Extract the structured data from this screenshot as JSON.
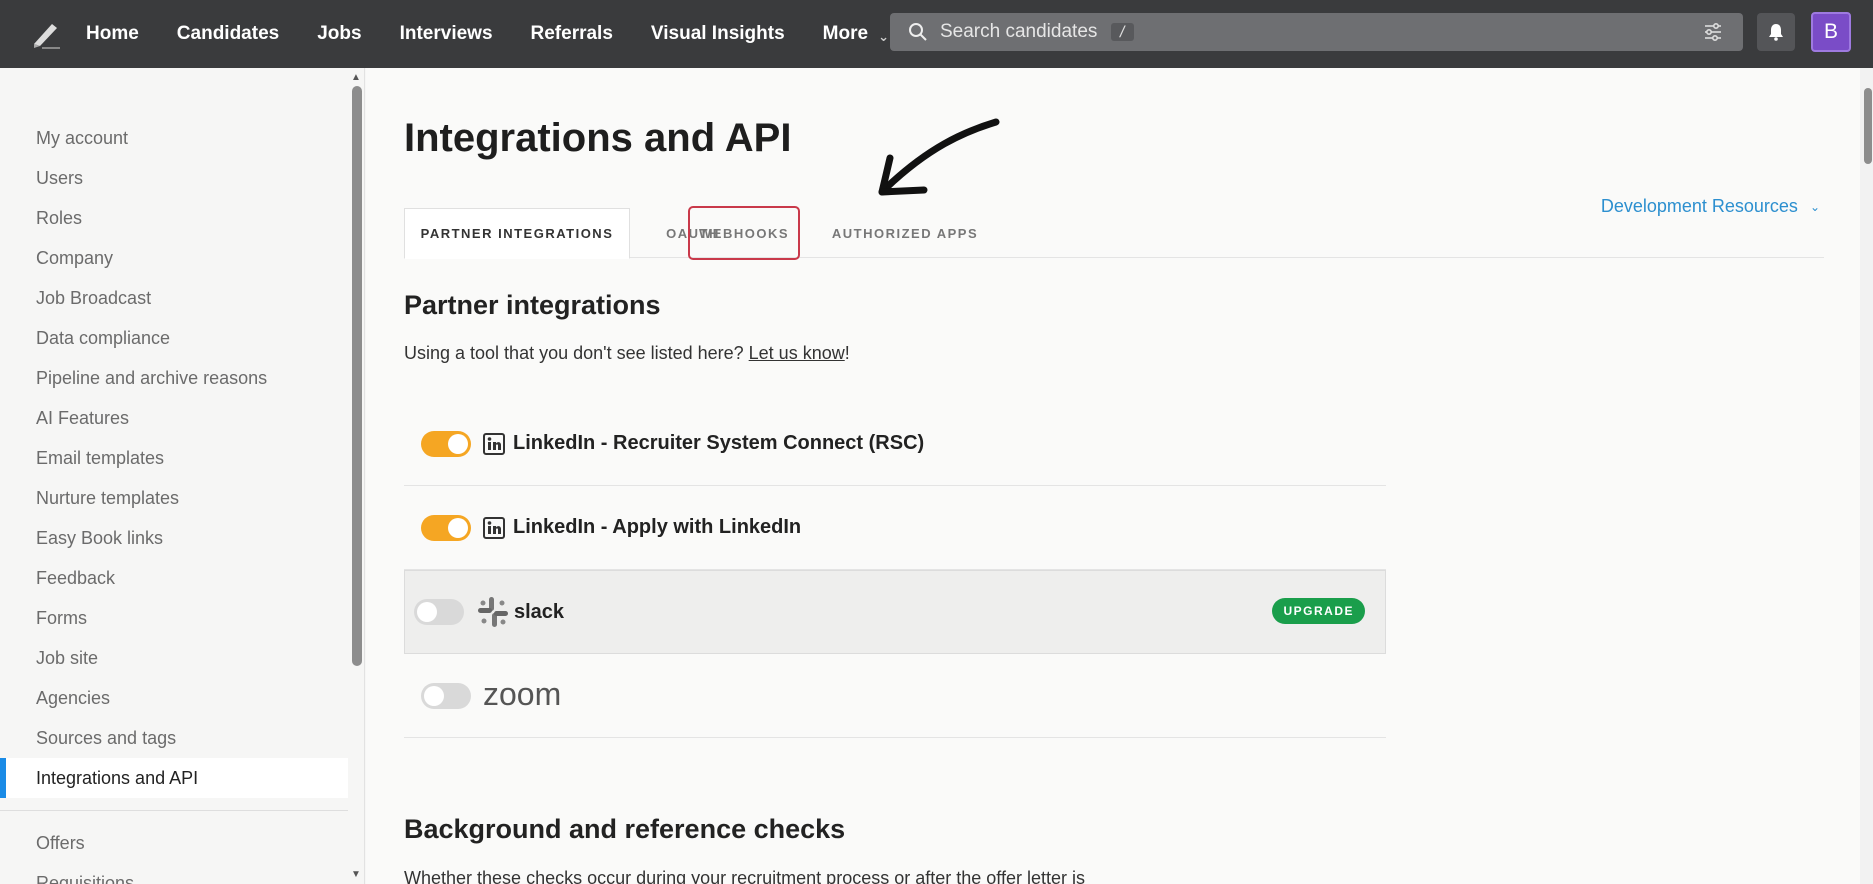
{
  "nav": {
    "items": [
      {
        "label": "Home"
      },
      {
        "label": "Candidates"
      },
      {
        "label": "Jobs"
      },
      {
        "label": "Interviews"
      },
      {
        "label": "Referrals"
      },
      {
        "label": "Visual Insights"
      },
      {
        "label": "More"
      }
    ],
    "search_placeholder": "Search candidates",
    "search_shortcut": "/",
    "avatar_initial": "B"
  },
  "sidebar": {
    "items": [
      {
        "label": "My account"
      },
      {
        "label": "Users"
      },
      {
        "label": "Roles"
      },
      {
        "label": "Company"
      },
      {
        "label": "Job Broadcast"
      },
      {
        "label": "Data compliance"
      },
      {
        "label": "Pipeline and archive reasons"
      },
      {
        "label": "AI Features"
      },
      {
        "label": "Email templates"
      },
      {
        "label": "Nurture templates"
      },
      {
        "label": "Easy Book links"
      },
      {
        "label": "Feedback"
      },
      {
        "label": "Forms"
      },
      {
        "label": "Job site"
      },
      {
        "label": "Agencies"
      },
      {
        "label": "Sources and tags"
      },
      {
        "label": "Integrations and API",
        "active": true
      }
    ],
    "secondary_items": [
      {
        "label": "Offers"
      },
      {
        "label": "Requisitions"
      }
    ]
  },
  "page": {
    "title": "Integrations and API",
    "dev_resources": "Development Resources",
    "tabs": [
      {
        "label": "PARTNER INTEGRATIONS",
        "active": true
      },
      {
        "label": "OAUTH"
      },
      {
        "label": "WEBHOOKS",
        "highlighted": true
      },
      {
        "label": "AUTHORIZED APPS"
      }
    ]
  },
  "partner": {
    "title": "Partner integrations",
    "desc_prefix": "Using a tool that you don't see listed here? ",
    "desc_link": "Let us know",
    "desc_suffix": "!",
    "integrations": [
      {
        "name": "LinkedIn - Recruiter System Connect (RSC)",
        "enabled": true,
        "icon": "linkedin-icon"
      },
      {
        "name": "LinkedIn - Apply with LinkedIn",
        "enabled": true,
        "icon": "linkedin-icon"
      },
      {
        "name": "slack",
        "enabled": false,
        "icon": "slack-icon",
        "badge": "UPGRADE"
      },
      {
        "name": "zoom",
        "enabled": false,
        "icon": "zoom-logo"
      }
    ]
  },
  "background_checks": {
    "title": "Background and reference checks",
    "desc": "Whether these checks occur during your recruitment process or after the offer letter is"
  },
  "colors": {
    "topbar": "#3a3b3d",
    "accent_blue": "#1a8be6",
    "toggle_on": "#f5a623",
    "upgrade_green": "#1a9e4b",
    "highlight_red": "#c9394a",
    "avatar_purple": "#7a4cc7"
  }
}
